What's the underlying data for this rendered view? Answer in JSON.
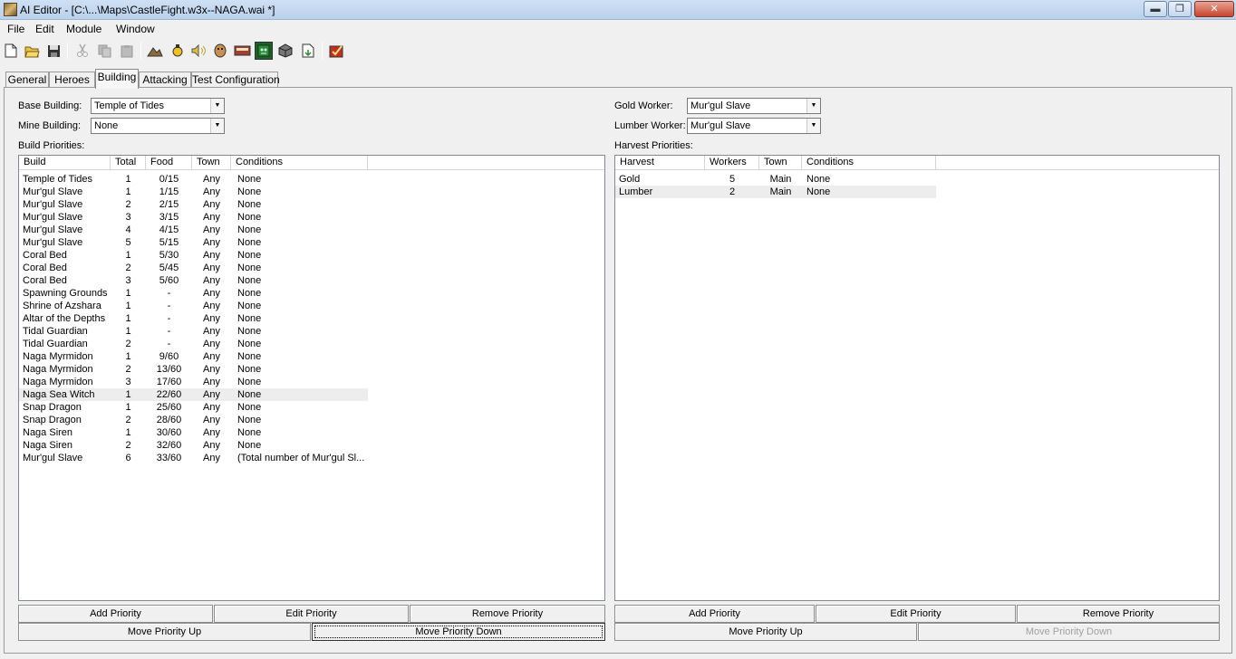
{
  "window": {
    "title": "AI Editor - [C:\\...\\Maps\\CastleFight.w3x--NAGA.wai *]"
  },
  "window_controls": {
    "minimize": "▬",
    "maximize": "❐",
    "close": "✕"
  },
  "menu": [
    "File",
    "Edit",
    "Module",
    "Window"
  ],
  "toolbar_icons": [
    "new-file-icon",
    "open-folder-icon",
    "save-icon",
    "cut-icon",
    "copy-icon",
    "paste-icon",
    "terrain-editor-icon",
    "trigger-editor-icon",
    "sound-editor-icon",
    "object-editor-icon",
    "campaign-editor-icon",
    "ai-editor-icon",
    "object-manager-icon",
    "import-manager-icon",
    "test-map-icon"
  ],
  "tabs": [
    "General",
    "Heroes",
    "Building",
    "Attacking",
    "Test Configuration"
  ],
  "active_tab": "Building",
  "left": {
    "base_building_label": "Base Building:",
    "base_building_value": "Temple of Tides",
    "mine_building_label": "Mine Building:",
    "mine_building_value": "None",
    "priorities_label": "Build Priorities:",
    "columns": [
      "Build",
      "Total",
      "Food",
      "Town",
      "Conditions"
    ],
    "rows": [
      [
        "Temple of Tides",
        "1",
        "0/15",
        "Any",
        "None"
      ],
      [
        "Mur'gul Slave",
        "1",
        "1/15",
        "Any",
        "None"
      ],
      [
        "Mur'gul Slave",
        "2",
        "2/15",
        "Any",
        "None"
      ],
      [
        "Mur'gul Slave",
        "3",
        "3/15",
        "Any",
        "None"
      ],
      [
        "Mur'gul Slave",
        "4",
        "4/15",
        "Any",
        "None"
      ],
      [
        "Mur'gul Slave",
        "5",
        "5/15",
        "Any",
        "None"
      ],
      [
        "Coral Bed",
        "1",
        "5/30",
        "Any",
        "None"
      ],
      [
        "Coral Bed",
        "2",
        "5/45",
        "Any",
        "None"
      ],
      [
        "Coral Bed",
        "3",
        "5/60",
        "Any",
        "None"
      ],
      [
        "Spawning Grounds",
        "1",
        "-",
        "Any",
        "None"
      ],
      [
        "Shrine of Azshara",
        "1",
        "-",
        "Any",
        "None"
      ],
      [
        "Altar of the Depths",
        "1",
        "-",
        "Any",
        "None"
      ],
      [
        "Tidal Guardian",
        "1",
        "-",
        "Any",
        "None"
      ],
      [
        "Tidal Guardian",
        "2",
        "-",
        "Any",
        "None"
      ],
      [
        "Naga Myrmidon",
        "1",
        "9/60",
        "Any",
        "None"
      ],
      [
        "Naga Myrmidon",
        "2",
        "13/60",
        "Any",
        "None"
      ],
      [
        "Naga Myrmidon",
        "3",
        "17/60",
        "Any",
        "None"
      ],
      [
        "Naga Sea Witch",
        "1",
        "22/60",
        "Any",
        "None"
      ],
      [
        "Snap Dragon",
        "1",
        "25/60",
        "Any",
        "None"
      ],
      [
        "Snap Dragon",
        "2",
        "28/60",
        "Any",
        "None"
      ],
      [
        "Naga Siren",
        "1",
        "30/60",
        "Any",
        "None"
      ],
      [
        "Naga Siren",
        "2",
        "32/60",
        "Any",
        "None"
      ],
      [
        "Mur'gul Slave",
        "6",
        "33/60",
        "Any",
        "(Total number of Mur'gul Sl..."
      ]
    ],
    "selected_row": 17,
    "buttons": {
      "add": "Add Priority",
      "edit": "Edit Priority",
      "remove": "Remove Priority",
      "up": "Move Priority Up",
      "down": "Move Priority Down"
    }
  },
  "right": {
    "gold_worker_label": "Gold Worker:",
    "gold_worker_value": "Mur'gul Slave",
    "lumber_worker_label": "Lumber Worker:",
    "lumber_worker_value": "Mur'gul Slave",
    "priorities_label": "Harvest Priorities:",
    "columns": [
      "Harvest",
      "Workers",
      "Town",
      "Conditions"
    ],
    "rows": [
      [
        "Gold",
        "5",
        "Main",
        "None"
      ],
      [
        "Lumber",
        "2",
        "Main",
        "None"
      ]
    ],
    "selected_row": 1,
    "buttons": {
      "add": "Add Priority",
      "edit": "Edit Priority",
      "remove": "Remove Priority",
      "up": "Move Priority Up",
      "down": "Move Priority Down"
    }
  }
}
